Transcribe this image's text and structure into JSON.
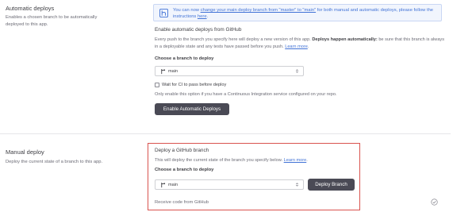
{
  "automatic": {
    "title": "Automatic deploys",
    "description": "Enables a chosen branch to be automatically deployed to this app.",
    "notice": {
      "prefix": "You can now ",
      "link": "change your main deploy branch from \"master\" to \"main\"",
      "middle": " for both manual and automatic deploys, please follow the instructions ",
      "here": "here",
      "suffix": "."
    },
    "section_heading": "Enable automatic deploys from GitHub",
    "explain_1": "Every push to the branch you specify here will deploy a new version of this app. ",
    "explain_bold": "Deploys happen automatically:",
    "explain_2": " be sure that this branch is always in a deployable state and any tests have passed before you push. ",
    "learn_more": "Learn more",
    "explain_end": ".",
    "choose_label": "Choose a branch to deploy",
    "branch_value": "main",
    "wait_ci_label": "Wait for CI to pass before deploy",
    "ci_note": "Only enable this option if you have a Continuous Integration service configured on your repo.",
    "enable_button": "Enable Automatic Deploys"
  },
  "manual": {
    "title": "Manual deploy",
    "description": "Deploy the current state of a branch to this app.",
    "section_heading": "Deploy a GitHub branch",
    "explain": "This will deploy the current state of the branch you specify below. ",
    "learn_more": "Learn more",
    "explain_end": ".",
    "choose_label": "Choose a branch to deploy",
    "branch_value": "main",
    "deploy_button": "Deploy Branch",
    "receive_label": "Receive code from GitHub"
  },
  "colors": {
    "accent_blue": "#4273d6",
    "highlight_red": "#d9534f",
    "button_dark": "#4a4a55"
  },
  "icons": {
    "notice": "heroku-logo-icon",
    "branch": "git-branch-icon",
    "select": "chevron-updown-icon",
    "status": "check-circle-icon"
  }
}
